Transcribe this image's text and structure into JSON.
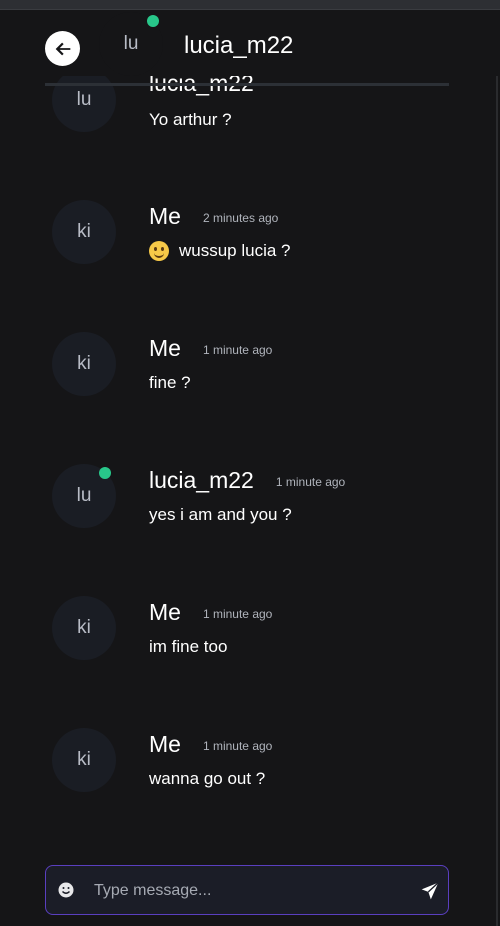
{
  "header": {
    "contact_initials": "lu",
    "contact_name": "lucia_m22",
    "online": true
  },
  "partial_top_message": {
    "initials": "lu",
    "name": "lucia_m22",
    "text": "Yo arthur ?"
  },
  "messages": [
    {
      "initials": "ki",
      "name": "Me",
      "time": "2 minutes ago",
      "text": "wussup lucia ?",
      "emoji": true,
      "online": false
    },
    {
      "initials": "ki",
      "name": "Me",
      "time": "1 minute ago",
      "text": "fine ?",
      "emoji": false,
      "online": false
    },
    {
      "initials": "lu",
      "name": "lucia_m22",
      "time": "1 minute ago",
      "text": "yes i am and you ?",
      "emoji": false,
      "online": true
    },
    {
      "initials": "ki",
      "name": "Me",
      "time": "1 minute ago",
      "text": "im fine too",
      "emoji": false,
      "online": false
    },
    {
      "initials": "ki",
      "name": "Me",
      "time": "1 minute ago",
      "text": "wanna go out ?",
      "emoji": false,
      "online": false
    }
  ],
  "composer": {
    "placeholder": "Type message..."
  },
  "colors": {
    "background": "#151517",
    "online": "#28c78a",
    "composer_border": "#5a3fc0"
  }
}
